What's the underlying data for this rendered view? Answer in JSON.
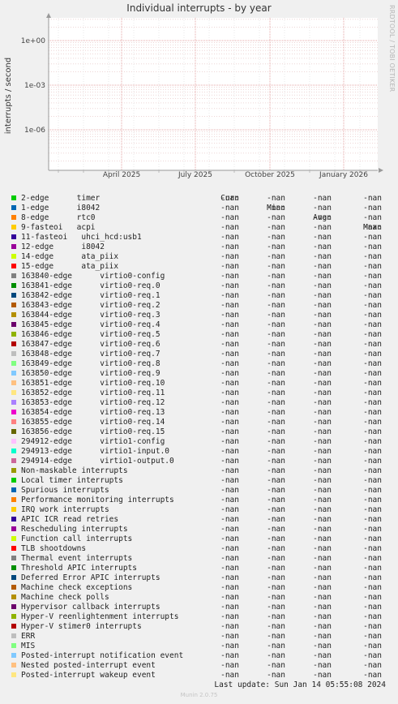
{
  "chart_data": {
    "type": "line",
    "title": "Individual interrupts - by year",
    "ylabel": "interrupts / second",
    "y_scale": "log",
    "y_ticks": [
      "1e+00",
      "1e-03",
      "1e-06"
    ],
    "x_ticks": [
      "April 2025",
      "July 2025",
      "October 2025",
      "January 2026"
    ],
    "grid": true,
    "series_values": "-nan"
  },
  "side_label": "RRDTOOL / TOBI OETIKER",
  "legend": {
    "headers": {
      "cur": "Cur:",
      "min": "Min:",
      "avg": "Avg:",
      "max": "Max:"
    },
    "rows": [
      {
        "label": "2-edge      timer",
        "color": "#00cc00",
        "cur": "-nan",
        "min": "-nan",
        "avg": "-nan",
        "max": "-nan"
      },
      {
        "label": "1-edge      i8042",
        "color": "#0066b3",
        "cur": "-nan",
        "min": "-nan",
        "avg": "-nan",
        "max": "-nan"
      },
      {
        "label": "8-edge      rtc0",
        "color": "#ff8000",
        "cur": "-nan",
        "min": "-nan",
        "avg": "-nan",
        "max": "-nan"
      },
      {
        "label": "9-fasteoi   acpi",
        "color": "#ffcc00",
        "cur": "-nan",
        "min": "-nan",
        "avg": "-nan",
        "max": "-nan"
      },
      {
        "label": "11-fasteoi   uhci_hcd:usb1",
        "color": "#330099",
        "cur": "-nan",
        "min": "-nan",
        "avg": "-nan",
        "max": "-nan"
      },
      {
        "label": "12-edge      i8042",
        "color": "#990099",
        "cur": "-nan",
        "min": "-nan",
        "avg": "-nan",
        "max": "-nan"
      },
      {
        "label": "14-edge      ata_piix",
        "color": "#ccff00",
        "cur": "-nan",
        "min": "-nan",
        "avg": "-nan",
        "max": "-nan"
      },
      {
        "label": "15-edge      ata_piix",
        "color": "#ff0000",
        "cur": "-nan",
        "min": "-nan",
        "avg": "-nan",
        "max": "-nan"
      },
      {
        "label": "163840-edge      virtio0-config",
        "color": "#808080",
        "cur": "-nan",
        "min": "-nan",
        "avg": "-nan",
        "max": "-nan"
      },
      {
        "label": "163841-edge      virtio0-req.0",
        "color": "#008f00",
        "cur": "-nan",
        "min": "-nan",
        "avg": "-nan",
        "max": "-nan"
      },
      {
        "label": "163842-edge      virtio0-req.1",
        "color": "#00487d",
        "cur": "-nan",
        "min": "-nan",
        "avg": "-nan",
        "max": "-nan"
      },
      {
        "label": "163843-edge      virtio0-req.2",
        "color": "#b35a00",
        "cur": "-nan",
        "min": "-nan",
        "avg": "-nan",
        "max": "-nan"
      },
      {
        "label": "163844-edge      virtio0-req.3",
        "color": "#b38f00",
        "cur": "-nan",
        "min": "-nan",
        "avg": "-nan",
        "max": "-nan"
      },
      {
        "label": "163845-edge      virtio0-req.4",
        "color": "#6b006b",
        "cur": "-nan",
        "min": "-nan",
        "avg": "-nan",
        "max": "-nan"
      },
      {
        "label": "163846-edge      virtio0-req.5",
        "color": "#8fb300",
        "cur": "-nan",
        "min": "-nan",
        "avg": "-nan",
        "max": "-nan"
      },
      {
        "label": "163847-edge      virtio0-req.6",
        "color": "#b30000",
        "cur": "-nan",
        "min": "-nan",
        "avg": "-nan",
        "max": "-nan"
      },
      {
        "label": "163848-edge      virtio0-req.7",
        "color": "#bebebe",
        "cur": "-nan",
        "min": "-nan",
        "avg": "-nan",
        "max": "-nan"
      },
      {
        "label": "163849-edge      virtio0-req.8",
        "color": "#80ff80",
        "cur": "-nan",
        "min": "-nan",
        "avg": "-nan",
        "max": "-nan"
      },
      {
        "label": "163850-edge      virtio0-req.9",
        "color": "#80c9ff",
        "cur": "-nan",
        "min": "-nan",
        "avg": "-nan",
        "max": "-nan"
      },
      {
        "label": "163851-edge      virtio0-req.10",
        "color": "#ffc080",
        "cur": "-nan",
        "min": "-nan",
        "avg": "-nan",
        "max": "-nan"
      },
      {
        "label": "163852-edge      virtio0-req.11",
        "color": "#ffe680",
        "cur": "-nan",
        "min": "-nan",
        "avg": "-nan",
        "max": "-nan"
      },
      {
        "label": "163853-edge      virtio0-req.12",
        "color": "#aa80ff",
        "cur": "-nan",
        "min": "-nan",
        "avg": "-nan",
        "max": "-nan"
      },
      {
        "label": "163854-edge      virtio0-req.13",
        "color": "#ee00cc",
        "cur": "-nan",
        "min": "-nan",
        "avg": "-nan",
        "max": "-nan"
      },
      {
        "label": "163855-edge      virtio0-req.14",
        "color": "#ff8080",
        "cur": "-nan",
        "min": "-nan",
        "avg": "-nan",
        "max": "-nan"
      },
      {
        "label": "163856-edge      virtio0-req.15",
        "color": "#666600",
        "cur": "-nan",
        "min": "-nan",
        "avg": "-nan",
        "max": "-nan"
      },
      {
        "label": "294912-edge      virtio1-config",
        "color": "#ffbfff",
        "cur": "-nan",
        "min": "-nan",
        "avg": "-nan",
        "max": "-nan"
      },
      {
        "label": "294913-edge      virtio1-input.0",
        "color": "#00ffcc",
        "cur": "-nan",
        "min": "-nan",
        "avg": "-nan",
        "max": "-nan"
      },
      {
        "label": "294914-edge      virtio1-output.0",
        "color": "#cc6699",
        "cur": "-nan",
        "min": "-nan",
        "avg": "-nan",
        "max": "-nan"
      },
      {
        "label": "Non-maskable interrupts",
        "color": "#999900",
        "cur": "-nan",
        "min": "-nan",
        "avg": "-nan",
        "max": "-nan"
      },
      {
        "label": "Local timer interrupts",
        "color": "#00cc00",
        "cur": "-nan",
        "min": "-nan",
        "avg": "-nan",
        "max": "-nan"
      },
      {
        "label": "Spurious interrupts",
        "color": "#0066b3",
        "cur": "-nan",
        "min": "-nan",
        "avg": "-nan",
        "max": "-nan"
      },
      {
        "label": "Performance monitoring interrupts",
        "color": "#ff8000",
        "cur": "-nan",
        "min": "-nan",
        "avg": "-nan",
        "max": "-nan"
      },
      {
        "label": "IRQ work interrupts",
        "color": "#ffcc00",
        "cur": "-nan",
        "min": "-nan",
        "avg": "-nan",
        "max": "-nan"
      },
      {
        "label": "APIC ICR read retries",
        "color": "#330099",
        "cur": "-nan",
        "min": "-nan",
        "avg": "-nan",
        "max": "-nan"
      },
      {
        "label": "Rescheduling interrupts",
        "color": "#990099",
        "cur": "-nan",
        "min": "-nan",
        "avg": "-nan",
        "max": "-nan"
      },
      {
        "label": "Function call interrupts",
        "color": "#ccff00",
        "cur": "-nan",
        "min": "-nan",
        "avg": "-nan",
        "max": "-nan"
      },
      {
        "label": "TLB shootdowns",
        "color": "#ff0000",
        "cur": "-nan",
        "min": "-nan",
        "avg": "-nan",
        "max": "-nan"
      },
      {
        "label": "Thermal event interrupts",
        "color": "#808080",
        "cur": "-nan",
        "min": "-nan",
        "avg": "-nan",
        "max": "-nan"
      },
      {
        "label": "Threshold APIC interrupts",
        "color": "#008f00",
        "cur": "-nan",
        "min": "-nan",
        "avg": "-nan",
        "max": "-nan"
      },
      {
        "label": "Deferred Error APIC interrupts",
        "color": "#00487d",
        "cur": "-nan",
        "min": "-nan",
        "avg": "-nan",
        "max": "-nan"
      },
      {
        "label": "Machine check exceptions",
        "color": "#b35a00",
        "cur": "-nan",
        "min": "-nan",
        "avg": "-nan",
        "max": "-nan"
      },
      {
        "label": "Machine check polls",
        "color": "#b38f00",
        "cur": "-nan",
        "min": "-nan",
        "avg": "-nan",
        "max": "-nan"
      },
      {
        "label": "Hypervisor callback interrupts",
        "color": "#6b006b",
        "cur": "-nan",
        "min": "-nan",
        "avg": "-nan",
        "max": "-nan"
      },
      {
        "label": "Hyper-V reenlightenment interrupts",
        "color": "#8fb300",
        "cur": "-nan",
        "min": "-nan",
        "avg": "-nan",
        "max": "-nan"
      },
      {
        "label": "Hyper-V stimer0 interrupts",
        "color": "#b30000",
        "cur": "-nan",
        "min": "-nan",
        "avg": "-nan",
        "max": "-nan"
      },
      {
        "label": "ERR",
        "color": "#bebebe",
        "cur": "-nan",
        "min": "-nan",
        "avg": "-nan",
        "max": "-nan"
      },
      {
        "label": "MIS",
        "color": "#80ff80",
        "cur": "-nan",
        "min": "-nan",
        "avg": "-nan",
        "max": "-nan"
      },
      {
        "label": "Posted-interrupt notification event",
        "color": "#80c9ff",
        "cur": "-nan",
        "min": "-nan",
        "avg": "-nan",
        "max": "-nan"
      },
      {
        "label": "Nested posted-interrupt event",
        "color": "#ffc080",
        "cur": "-nan",
        "min": "-nan",
        "avg": "-nan",
        "max": "-nan"
      },
      {
        "label": "Posted-interrupt wakeup event",
        "color": "#ffe680",
        "cur": "-nan",
        "min": "-nan",
        "avg": "-nan",
        "max": "-nan"
      }
    ]
  },
  "footer": {
    "last_update": "Last update: Sun Jan 14 05:55:08 2024",
    "version": "Munin 2.0.75"
  }
}
